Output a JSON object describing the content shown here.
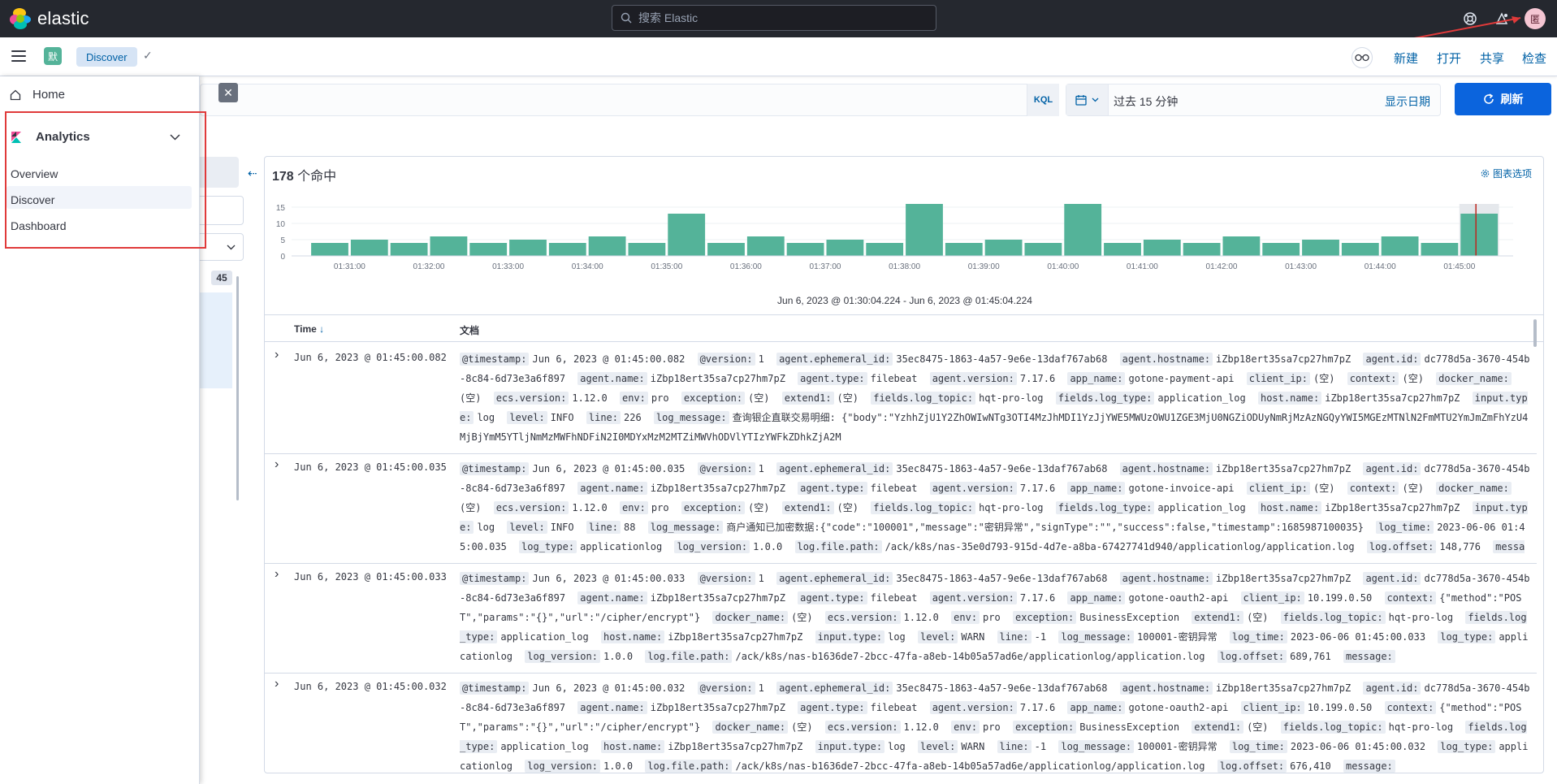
{
  "topbar": {
    "brand": "elastic",
    "search_placeholder": "搜索 Elastic",
    "avatar": "匿"
  },
  "subbar": {
    "space_badge": "默",
    "breadcrumb": "Discover",
    "links": [
      "新建",
      "打开",
      "共享",
      "检查"
    ]
  },
  "query": {
    "language": "KQL",
    "time_label": "过去 15 分钟",
    "show_dates": "显示日期",
    "refresh": "刷新"
  },
  "sidepanel": {
    "field_count": "45"
  },
  "nav": {
    "home": "Home",
    "section": "Analytics",
    "items": [
      "Overview",
      "Discover",
      "Dashboard"
    ],
    "active": "Discover"
  },
  "results": {
    "hit_count": "178",
    "hit_suffix": "个命中",
    "chart_options": "图表选项",
    "range": "Jun 6, 2023 @ 01:30:04.224 - Jun 6, 2023 @ 01:45:04.224",
    "col_time": "Time",
    "col_doc": "文档"
  },
  "chart_data": {
    "type": "bar",
    "categories": [
      "01:30:30",
      "01:31:00",
      "01:31:30",
      "01:32:00",
      "01:32:30",
      "01:33:00",
      "01:33:30",
      "01:34:00",
      "01:34:30",
      "01:35:00",
      "01:35:30",
      "01:36:00",
      "01:36:30",
      "01:37:00",
      "01:37:30",
      "01:38:00",
      "01:38:30",
      "01:39:00",
      "01:39:30",
      "01:40:00",
      "01:40:30",
      "01:41:00",
      "01:41:30",
      "01:42:00",
      "01:42:30",
      "01:43:00",
      "01:43:30",
      "01:44:00",
      "01:44:30",
      "01:45:00"
    ],
    "values": [
      4,
      5,
      4,
      6,
      4,
      5,
      4,
      6,
      4,
      13,
      4,
      6,
      4,
      5,
      4,
      16,
      4,
      5,
      4,
      16,
      4,
      5,
      4,
      6,
      4,
      5,
      4,
      6,
      4,
      13
    ],
    "x_tick_labels": [
      "01:31:00",
      "01:32:00",
      "01:33:00",
      "01:34:00",
      "01:35:00",
      "01:36:00",
      "01:37:00",
      "01:38:00",
      "01:39:00",
      "01:40:00",
      "01:41:00",
      "01:42:00",
      "01:43:00",
      "01:44:00",
      "01:45:00"
    ],
    "y_ticks": [
      "0",
      "5",
      "10",
      "15"
    ],
    "ylim": [
      0,
      16
    ],
    "color": "#54b399",
    "grid": true
  },
  "rows": [
    {
      "time": "Jun 6, 2023 @ 01:45:00.082",
      "fields": [
        [
          "@timestamp:",
          "Jun 6, 2023 @ 01:45:00.082"
        ],
        [
          "@version:",
          "1"
        ],
        [
          "agent.ephemeral_id:",
          "35ec8475-1863-4a57-9e6e-13daf767ab68"
        ],
        [
          "agent.hostname:",
          "iZbp18ert35sa7cp27hm7pZ"
        ],
        [
          "agent.id:",
          "dc778d5a-3670-454b-8c84-6d73e3a6f897"
        ],
        [
          "agent.name:",
          "iZbp18ert35sa7cp27hm7pZ"
        ],
        [
          "agent.type:",
          "filebeat"
        ],
        [
          "agent.version:",
          "7.17.6"
        ],
        [
          "app_name:",
          "gotone-payment-api"
        ],
        [
          "client_ip:",
          "(空)"
        ],
        [
          "context:",
          "(空)"
        ],
        [
          "docker_name:",
          "(空)"
        ],
        [
          "ecs.version:",
          "1.12.0"
        ],
        [
          "env:",
          "pro"
        ],
        [
          "exception:",
          "(空)"
        ],
        [
          "extend1:",
          "(空)"
        ],
        [
          "fields.log_topic:",
          "hqt-pro-log"
        ],
        [
          "fields.log_type:",
          "application_log"
        ],
        [
          "host.name:",
          "iZbp18ert35sa7cp27hm7pZ"
        ],
        [
          "input.type:",
          "log"
        ],
        [
          "level:",
          "INFO"
        ],
        [
          "line:",
          "226"
        ],
        [
          "log_message:",
          "查询银企直联交易明细: {\"body\":\"YzhhZjU1Y2ZhOWIwNTg3OTI4MzJhMDI1YzJjYWE5MWUzOWU1ZGE3MjU0NGZiODUyNmRjMzAzNGQyYWI5MGEzMTNlN2FmMTU2YmJmZmFhYzU4MjBjYmM5YTljNmMzMWFhNDFiN2I0MDYxMzM2MTZiMWVhODVlYTIzYWFkZDhkZjA2M"
        ]
      ]
    },
    {
      "time": "Jun 6, 2023 @ 01:45:00.035",
      "fields": [
        [
          "@timestamp:",
          "Jun 6, 2023 @ 01:45:00.035"
        ],
        [
          "@version:",
          "1"
        ],
        [
          "agent.ephemeral_id:",
          "35ec8475-1863-4a57-9e6e-13daf767ab68"
        ],
        [
          "agent.hostname:",
          "iZbp18ert35sa7cp27hm7pZ"
        ],
        [
          "agent.id:",
          "dc778d5a-3670-454b-8c84-6d73e3a6f897"
        ],
        [
          "agent.name:",
          "iZbp18ert35sa7cp27hm7pZ"
        ],
        [
          "agent.type:",
          "filebeat"
        ],
        [
          "agent.version:",
          "7.17.6"
        ],
        [
          "app_name:",
          "gotone-invoice-api"
        ],
        [
          "client_ip:",
          "(空)"
        ],
        [
          "context:",
          "(空)"
        ],
        [
          "docker_name:",
          "(空)"
        ],
        [
          "ecs.version:",
          "1.12.0"
        ],
        [
          "env:",
          "pro"
        ],
        [
          "exception:",
          "(空)"
        ],
        [
          "extend1:",
          "(空)"
        ],
        [
          "fields.log_topic:",
          "hqt-pro-log"
        ],
        [
          "fields.log_type:",
          "application_log"
        ],
        [
          "host.name:",
          "iZbp18ert35sa7cp27hm7pZ"
        ],
        [
          "input.type:",
          "log"
        ],
        [
          "level:",
          "INFO"
        ],
        [
          "line:",
          "88"
        ],
        [
          "log_message:",
          "商户通知已加密数据:{\"code\":\"100001\",\"message\":\"密钥异常\",\"signType\":\"\",\"success\":false,\"timestamp\":1685987100035}"
        ],
        [
          "log_time:",
          "2023-06-06 01:45:00.035"
        ],
        [
          "log_type:",
          "applicationlog"
        ],
        [
          "log_version:",
          "1.0.0"
        ],
        [
          "log.file.path:",
          "/ack/k8s/nas-35e0d793-915d-4d7e-a8ba-67427741d940/applicationlog/application.log"
        ],
        [
          "log.offset:",
          "148,776"
        ],
        [
          "message:",
          ""
        ]
      ]
    },
    {
      "time": "Jun 6, 2023 @ 01:45:00.033",
      "fields": [
        [
          "@timestamp:",
          "Jun 6, 2023 @ 01:45:00.033"
        ],
        [
          "@version:",
          "1"
        ],
        [
          "agent.ephemeral_id:",
          "35ec8475-1863-4a57-9e6e-13daf767ab68"
        ],
        [
          "agent.hostname:",
          "iZbp18ert35sa7cp27hm7pZ"
        ],
        [
          "agent.id:",
          "dc778d5a-3670-454b-8c84-6d73e3a6f897"
        ],
        [
          "agent.name:",
          "iZbp18ert35sa7cp27hm7pZ"
        ],
        [
          "agent.type:",
          "filebeat"
        ],
        [
          "agent.version:",
          "7.17.6"
        ],
        [
          "app_name:",
          "gotone-oauth2-api"
        ],
        [
          "client_ip:",
          "10.199.0.50"
        ],
        [
          "context:",
          "{\"method\":\"POST\",\"params\":\"{}\",\"url\":\"/cipher/encrypt\"}"
        ],
        [
          "docker_name:",
          "(空)"
        ],
        [
          "ecs.version:",
          "1.12.0"
        ],
        [
          "env:",
          "pro"
        ],
        [
          "exception:",
          "BusinessException"
        ],
        [
          "extend1:",
          "(空)"
        ],
        [
          "fields.log_topic:",
          "hqt-pro-log"
        ],
        [
          "fields.log_type:",
          "application_log"
        ],
        [
          "host.name:",
          "iZbp18ert35sa7cp27hm7pZ"
        ],
        [
          "input.type:",
          "log"
        ],
        [
          "level:",
          "WARN"
        ],
        [
          "line:",
          "-1"
        ],
        [
          "log_message:",
          "100001-密钥异常"
        ],
        [
          "log_time:",
          "2023-06-06 01:45:00.033"
        ],
        [
          "log_type:",
          "applicationlog"
        ],
        [
          "log_version:",
          "1.0.0"
        ],
        [
          "log.file.path:",
          "/ack/k8s/nas-b1636de7-2bcc-47fa-a8eb-14b05a57ad6e/applicationlog/application.log"
        ],
        [
          "log.offset:",
          "689,761"
        ],
        [
          "message:",
          ""
        ]
      ]
    },
    {
      "time": "Jun 6, 2023 @ 01:45:00.032",
      "fields": [
        [
          "@timestamp:",
          "Jun 6, 2023 @ 01:45:00.032"
        ],
        [
          "@version:",
          "1"
        ],
        [
          "agent.ephemeral_id:",
          "35ec8475-1863-4a57-9e6e-13daf767ab68"
        ],
        [
          "agent.hostname:",
          "iZbp18ert35sa7cp27hm7pZ"
        ],
        [
          "agent.id:",
          "dc778d5a-3670-454b-8c84-6d73e3a6f897"
        ],
        [
          "agent.name:",
          "iZbp18ert35sa7cp27hm7pZ"
        ],
        [
          "agent.type:",
          "filebeat"
        ],
        [
          "agent.version:",
          "7.17.6"
        ],
        [
          "app_name:",
          "gotone-oauth2-api"
        ],
        [
          "client_ip:",
          "10.199.0.50"
        ],
        [
          "context:",
          "{\"method\":\"POST\",\"params\":\"{}\",\"url\":\"/cipher/encrypt\"}"
        ],
        [
          "docker_name:",
          "(空)"
        ],
        [
          "ecs.version:",
          "1.12.0"
        ],
        [
          "env:",
          "pro"
        ],
        [
          "exception:",
          "BusinessException"
        ],
        [
          "extend1:",
          "(空)"
        ],
        [
          "fields.log_topic:",
          "hqt-pro-log"
        ],
        [
          "fields.log_type:",
          "application_log"
        ],
        [
          "host.name:",
          "iZbp18ert35sa7cp27hm7pZ"
        ],
        [
          "input.type:",
          "log"
        ],
        [
          "level:",
          "WARN"
        ],
        [
          "line:",
          "-1"
        ],
        [
          "log_message:",
          "100001-密钥异常"
        ],
        [
          "log_time:",
          "2023-06-06 01:45:00.032"
        ],
        [
          "log_type:",
          "applicationlog"
        ],
        [
          "log_version:",
          "1.0.0"
        ],
        [
          "log.file.path:",
          "/ack/k8s/nas-b1636de7-2bcc-47fa-a8eb-14b05a57ad6e/applicationlog/application.log"
        ],
        [
          "log.offset:",
          "676,410"
        ],
        [
          "message:",
          ""
        ]
      ]
    }
  ]
}
